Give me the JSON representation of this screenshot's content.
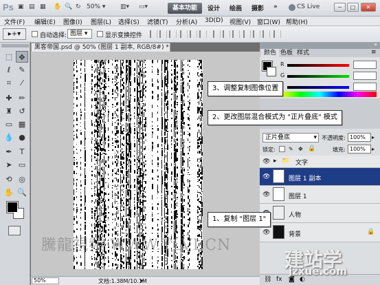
{
  "titlebar": {
    "app_logo": "Ps",
    "zoom": "50%",
    "workspace_active": "基本功能",
    "workspaces": [
      "设计",
      "绘画",
      "摄影"
    ],
    "more": "»",
    "cs_live": "CS Live",
    "window_buttons": [
      "−",
      "□",
      "✕"
    ]
  },
  "menu": [
    "文件(F)",
    "编辑(E)",
    "图像(I)",
    "图层(L)",
    "选择(S)",
    "滤镜(T)",
    "分析(A)",
    "3D(D)",
    "视图(V)",
    "窗口(W)",
    "帮助(H)"
  ],
  "options": {
    "auto_select_label": "自动选择:",
    "auto_select_value": "图层",
    "show_transform_label": "显示变换控件"
  },
  "document": {
    "tab_title": "黑客帝国.psd @ 50% (图层 1 副本, RGB/8#) *",
    "close": "×",
    "status_zoom": "50%",
    "status_doc": "文档:1.38M/10.1M"
  },
  "callouts": {
    "step3": "3、调整复制图像位置",
    "step2": "2、更改图层混合模式为 \"正片叠底\" 模式",
    "step1": "1、复制 \"图层 1\""
  },
  "panels": {
    "color_tabs": [
      "颜色",
      "色板",
      "样式"
    ],
    "color_channels": [
      "R",
      "G",
      "B"
    ],
    "blend_mode": "正片叠底",
    "opacity_label": "不透明度:",
    "opacity_value": "100%",
    "lock_label": "锁定:",
    "fill_label": "填充:",
    "fill_value": "100%",
    "layers": [
      {
        "name": "文字",
        "type": "group"
      },
      {
        "name": "图层 1 副本",
        "selected": true
      },
      {
        "name": "图层 1"
      },
      {
        "name": "人物"
      },
      {
        "name": "背景"
      }
    ]
  },
  "watermark": {
    "left_text": "騰龍視頻 WWW.TLVI.CN",
    "right_text": "建站学",
    "url": "jzxue.com"
  },
  "colors": {
    "selected_layer": "#1f3c86",
    "workspace_active_bg": "#5a5f67"
  }
}
